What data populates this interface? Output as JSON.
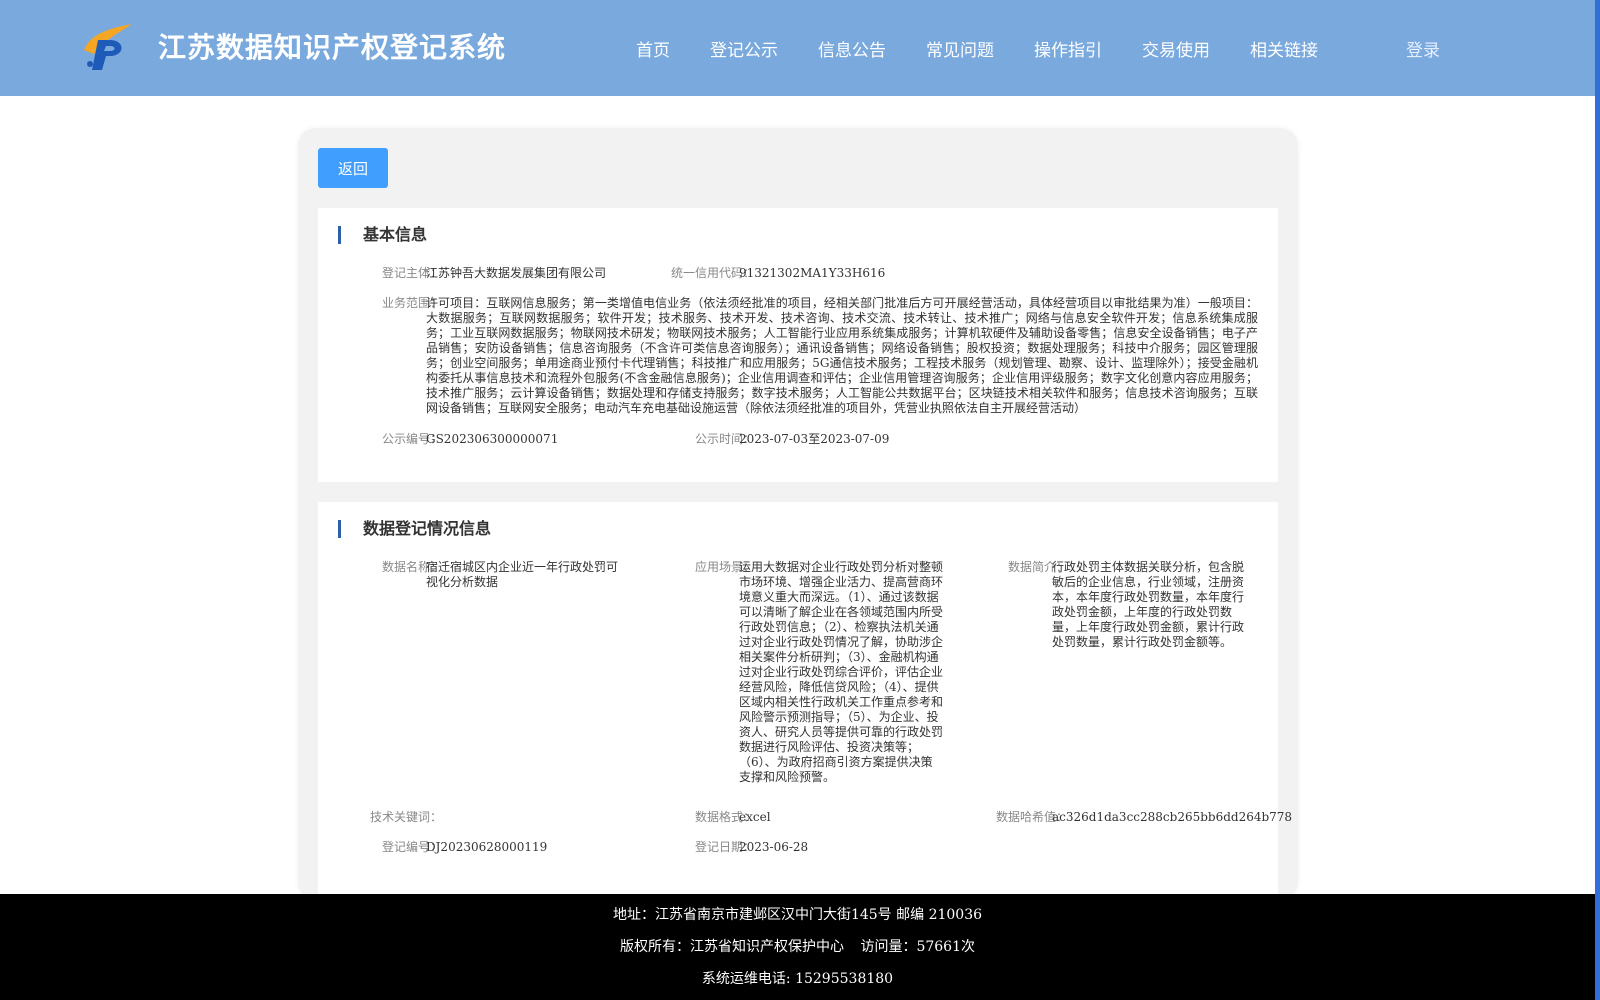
{
  "header": {
    "site_title": "江苏数据知识产权登记系统",
    "nav": [
      "首页",
      "登记公示",
      "信息公告",
      "常见问题",
      "操作指引",
      "交易使用",
      "相关链接"
    ],
    "login_label": "登录"
  },
  "back_label": "返回",
  "basic_info": {
    "section_title": "基本信息",
    "registrant_label": "登记主体：",
    "registrant": "江苏钟吾大数据发展集团有限公司",
    "credit_code_label": "统一信用代码：",
    "credit_code": "91321302MA1Y33H616",
    "scope_label": "业务范围：",
    "scope": "许可项目：互联网信息服务；第一类增值电信业务（依法须经批准的项目，经相关部门批准后方可开展经营活动，具体经营项目以审批结果为准）一般项目：大数据服务；互联网数据服务；软件开发；技术服务、技术开发、技术咨询、技术交流、技术转让、技术推广；网络与信息安全软件开发；信息系统集成服务；工业互联网数据服务；物联网技术研发；物联网技术服务；人工智能行业应用系统集成服务；计算机软硬件及辅助设备零售；信息安全设备销售；电子产品销售；安防设备销售；信息咨询服务（不含许可类信息咨询服务）；通讯设备销售；网络设备销售；股权投资；数据处理服务；科技中介服务；园区管理服务；创业空间服务；单用途商业预付卡代理销售；科技推广和应用服务；5G通信技术服务；工程技术服务（规划管理、勘察、设计、监理除外）；接受金融机构委托从事信息技术和流程外包服务(不含金融信息服务)；企业信用调查和评估；企业信用管理咨询服务；企业信用评级服务；数字文化创意内容应用服务；技术推广服务；云计算设备销售；数据处理和存储支持服务；数字技术服务；人工智能公共数据平台；区块链技术相关软件和服务；信息技术咨询服务；互联网设备销售；互联网安全服务；电动汽车充电基础设施运营（除依法须经批准的项目外，凭营业执照依法自主开展经营活动）",
    "notice_no_label": "公示编号：",
    "notice_no": "GS202306300000071",
    "notice_time_label": "公示时间：",
    "notice_time": "2023-07-03至2023-07-09"
  },
  "data_reg": {
    "section_title": "数据登记情况信息",
    "name_label": "数据名称：",
    "name": "宿迁宿城区内企业近一年行政处罚可视化分析数据",
    "scene_label": "应用场景：",
    "scene": "运用大数据对企业行政处罚分析对整顿市场环境、增强企业活力、提高营商环境意义重大而深远。（1）、通过该数据可以清晰了解企业在各领域范围内所受行政处罚信息；（2）、检察执法机关通过对企业行政处罚情况了解，协助涉企相关案件分析研判；（3）、金融机构通过对企业行政处罚综合评价，评估企业经营风险，降低信贷风险；（4）、提供区域内相关性行政机关工作重点参考和风险警示预测指导；（5）、为企业、投资人、研究人员等提供可靠的行政处罚数据进行风险评估、投资决策等；（6）、为政府招商引资方案提供决策支撑和风险预警。",
    "intro_label": "数据简介：",
    "intro": "行政处罚主体数据关联分析，包含脱敏后的企业信息，行业领域，注册资本，本年度行政处罚数量，本年度行政处罚金额，上年度的行政处罚数量，上年度行政处罚金额，累计行政处罚数量，累计行政处罚金额等。",
    "keywords_label": "技术关键词：",
    "keywords": "",
    "format_label": "数据格式：",
    "format": "excel",
    "hash_label": "数据哈希值：",
    "hash": "ac326d1da3cc288cb265bb6dd264b778",
    "reg_no_label": "登记编号：",
    "reg_no": "DJ20230628000119",
    "reg_date_label": "登记日期：",
    "reg_date": "2023-06-28"
  },
  "footer": {
    "address": "地址：江苏省南京市建邺区汉中门大街145号 邮编 210036",
    "copyright": "版权所有：江苏省知识产权保护中心",
    "visits": "访问量：57661次",
    "hotline": "系统运维电话: 15295538180"
  }
}
